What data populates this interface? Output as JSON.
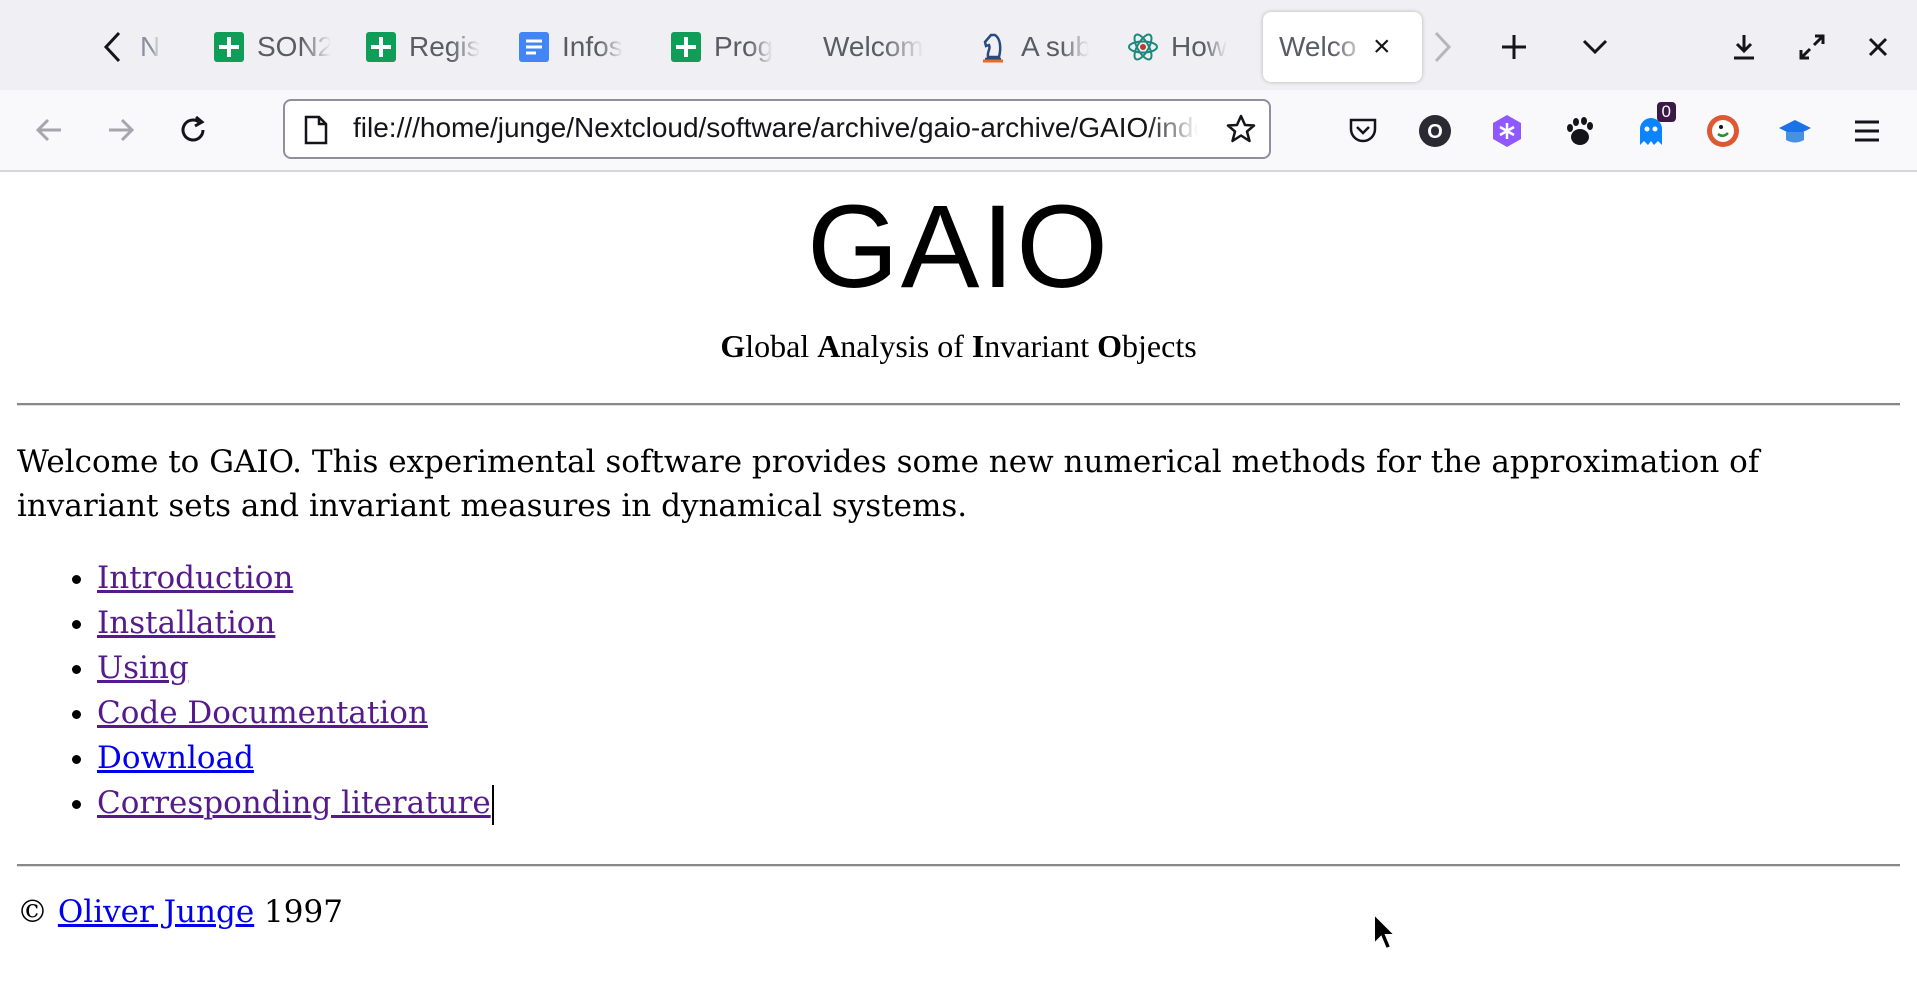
{
  "tabs": [
    {
      "label": "N",
      "icon": "generic-tab-icon"
    },
    {
      "label": "SON2",
      "icon": "google-sheets-icon"
    },
    {
      "label": "Regis",
      "icon": "google-sheets-icon"
    },
    {
      "label": "Infos",
      "icon": "google-docs-icon"
    },
    {
      "label": "Prog",
      "icon": "google-sheets-icon"
    },
    {
      "label": "Welcom",
      "icon": ""
    },
    {
      "label": "A sub",
      "icon": "chess-knight-icon"
    },
    {
      "label": "How",
      "icon": "atom-icon"
    },
    {
      "label": "Welco",
      "icon": "",
      "active": true
    }
  ],
  "navbar": {
    "url": "file:///home/junge/Nextcloud/software/archive/gaio-archive/GAIO/index.html",
    "extension_badge": "0"
  },
  "page": {
    "logo": "GAIO",
    "subtitle": [
      {
        "initial": "G",
        "rest": "lobal "
      },
      {
        "initial": "A",
        "rest": "nalysis of "
      },
      {
        "initial": "I",
        "rest": "nvariant "
      },
      {
        "initial": "O",
        "rest": "bjects"
      }
    ],
    "intro": "Welcome to GAIO. This experimental software provides some new numerical methods for the approximation of invariant sets and invariant measures in dynamical systems.",
    "links": [
      {
        "label": "Introduction",
        "visited": true
      },
      {
        "label": "Installation",
        "visited": true
      },
      {
        "label": "Using",
        "visited": true
      },
      {
        "label": "Code Documentation",
        "visited": true
      },
      {
        "label": "Download",
        "visited": false
      },
      {
        "label": "Corresponding literature",
        "visited": true
      }
    ],
    "footer": {
      "copyright": "©",
      "author": "Oliver Junge",
      "year": "1997"
    }
  },
  "colors": {
    "visited_link": "#551a8b",
    "unvisited_link": "#0000ee",
    "tabbar_bg": "#f0f0f4"
  }
}
